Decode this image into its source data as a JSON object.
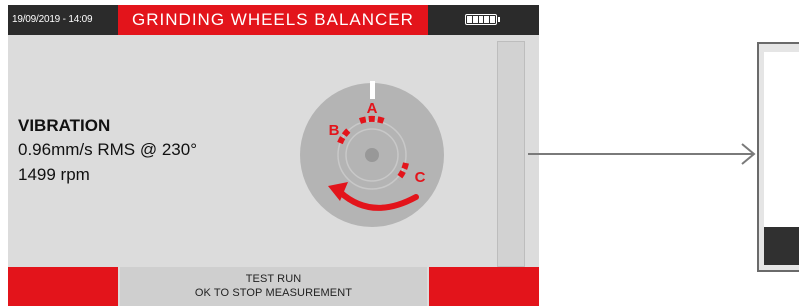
{
  "header": {
    "datetime": "19/09/2019 - 14:09",
    "title": "GRINDING WHEELS BALANCER",
    "battery_icon": "battery-full-icon"
  },
  "measurement": {
    "label": "VIBRATION",
    "value": "0.96mm/s RMS @ 230°",
    "rpm": "1499 rpm"
  },
  "wheel": {
    "labels": [
      "A",
      "B",
      "C"
    ],
    "rotation_icon": "rotation-arrow-icon"
  },
  "footer": {
    "line1": "TEST RUN",
    "line2": "OK TO STOP MEASUREMENT"
  },
  "colors": {
    "accent_red": "#e3141b",
    "header_dark": "#2b2b2b",
    "screen_bg": "#dcdcdc",
    "wheel_gray": "#b4b4b4"
  }
}
